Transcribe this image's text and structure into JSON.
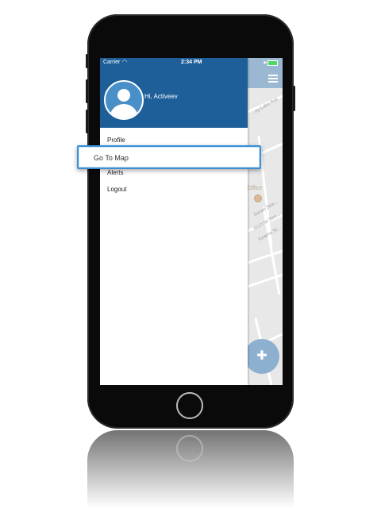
{
  "status_bar": {
    "carrier": "Carrier",
    "time": "2:34 PM"
  },
  "drawer": {
    "greeting": "Hi, Activeev",
    "menu_items": [
      "Profile",
      "Alerts",
      "Logout"
    ],
    "highlighted_item": "Go To Map"
  },
  "map": {
    "street_labels": [
      "...ey Lake Ave",
      "Duran Stre...",
      "Mabola Stre...",
      "Kearns St..."
    ],
    "poi_label": "Office"
  },
  "icons": {
    "avatar": "user-avatar-icon",
    "menu": "hamburger-menu-icon",
    "fab": "location-pin-plus-icon"
  },
  "colors": {
    "drawer_header": "#1e5f99",
    "accent": "#3a8fd6",
    "map_topbar": "#9bb8d2",
    "fab": "#8eb0d0"
  }
}
